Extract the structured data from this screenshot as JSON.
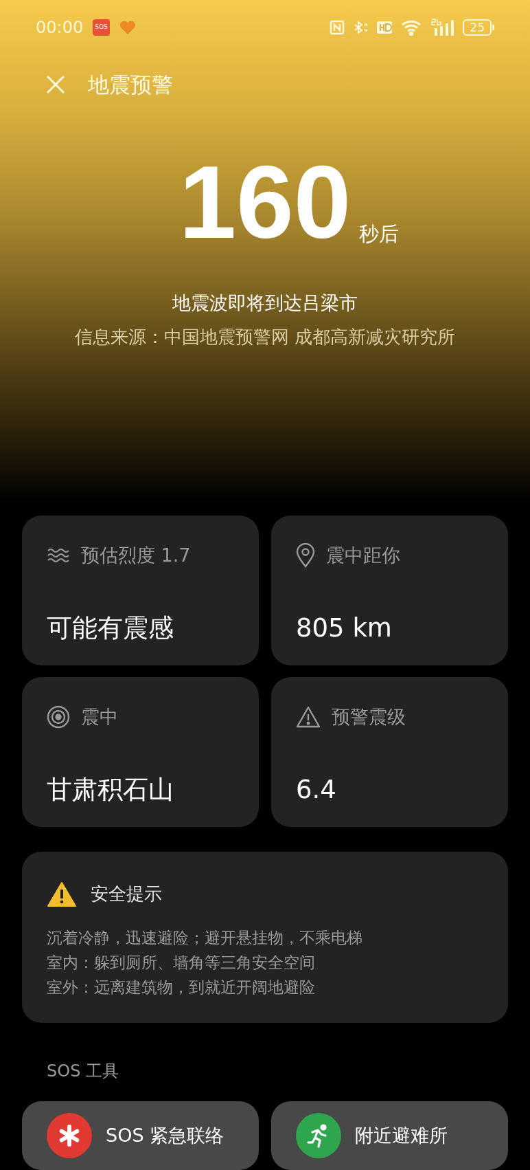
{
  "status_bar": {
    "time": "00:00",
    "sos_badge": "SOS",
    "battery": "25"
  },
  "header": {
    "title": "地震预警"
  },
  "countdown": {
    "value": "160",
    "unit": "秒后"
  },
  "message": "地震波即将到达吕梁市",
  "source": "信息来源：中国地震预警网 成都高新减灾研究所",
  "cards": [
    {
      "label": "预估烈度 1.7",
      "value": "可能有震感"
    },
    {
      "label": "震中距你",
      "value": "805 km"
    },
    {
      "label": "震中",
      "value": "甘肃积石山"
    },
    {
      "label": "预警震级",
      "value": "6.4"
    }
  ],
  "safety": {
    "title": "安全提示",
    "lines": [
      "沉着冷静，迅速避险；避开悬挂物，不乘电梯",
      "室内：躲到厕所、墙角等三角安全空间",
      "室外：远离建筑物，到就近开阔地避险"
    ]
  },
  "sos_tools": {
    "heading": "SOS 工具",
    "buttons": [
      {
        "label": "SOS 紧急联络",
        "color": "#e03a32"
      },
      {
        "label": "附近避难所",
        "color": "#2fa54e"
      }
    ]
  }
}
